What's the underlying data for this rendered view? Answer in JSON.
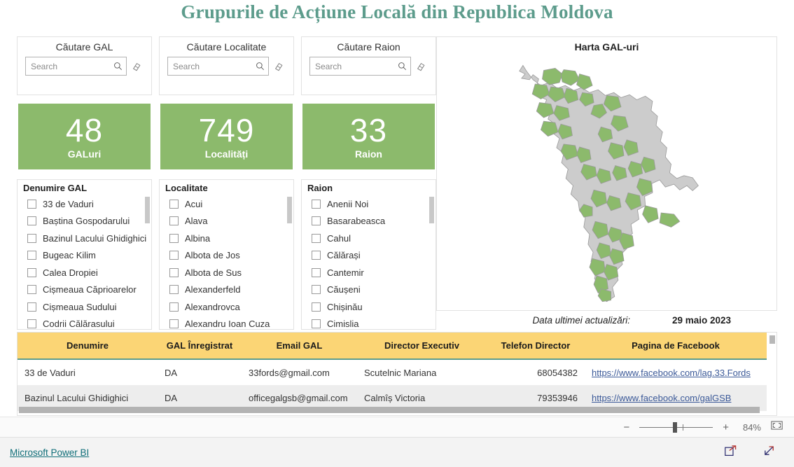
{
  "report": {
    "title": "Grupurile de Acțiune Locală din Republica Moldova",
    "accent_teal": "#5d9c8c",
    "kpi_green": "#8cba6c",
    "table_header_yellow": "#fbd575"
  },
  "slicers": [
    {
      "title": "Căutare GAL",
      "placeholder": "Search",
      "value": "",
      "search_icon": "search-icon",
      "clear_icon": "eraser-icon"
    },
    {
      "title": "Căutare Localitate",
      "placeholder": "Search",
      "value": "",
      "search_icon": "search-icon",
      "clear_icon": "eraser-icon"
    },
    {
      "title": "Căutare Raion",
      "placeholder": "Search",
      "value": "",
      "search_icon": "search-icon",
      "clear_icon": "eraser-icon"
    }
  ],
  "kpis": [
    {
      "value": "48",
      "label": "GALuri"
    },
    {
      "value": "749",
      "label": "Localități"
    },
    {
      "value": "33",
      "label": "Raion"
    }
  ],
  "lists": [
    {
      "header": "Denumire GAL",
      "items": [
        "33 de Vaduri",
        "Baștina Gospodarului",
        "Bazinul Lacului Ghidighici",
        "Bugeac Kilim",
        "Calea Dropiei",
        "Cișmeaua Căprioarelor",
        "Cișmeaua Sudului",
        "Codrii Călărasului"
      ]
    },
    {
      "header": "Localitate",
      "items": [
        "Acui",
        "Alava",
        "Albina",
        "Albota de Jos",
        "Albota de Sus",
        "Alexanderfeld",
        "Alexandrovca",
        "Alexandru Ioan Cuza"
      ]
    },
    {
      "header": "Raion",
      "items": [
        "Anenii Noi",
        "Basarabeasca",
        "Cahul",
        "Călărași",
        "Cantemir",
        "Căușeni",
        "Chișinău",
        "Cimislia"
      ]
    }
  ],
  "map": {
    "title": "Harta GAL-uri",
    "region_fill": "#8cba6c",
    "base_fill": "#cccccc"
  },
  "update": {
    "label": "Data ultimei actualizări:",
    "value": "29 maio 2023"
  },
  "table": {
    "columns": [
      "Denumire",
      "GAL Înregistrat",
      "Email GAL",
      "Director Executiv",
      "Telefon Director",
      "Pagina de Facebook"
    ],
    "rows": [
      {
        "denumire": "33 de Vaduri",
        "inregistrat": "DA",
        "email": "33fords@gmail.com",
        "director": "Scutelnic Mariana",
        "telefon": "68054382",
        "facebook": "https://www.facebook.com/lag.33.Fords"
      },
      {
        "denumire": "Bazinul Lacului Ghidighici",
        "inregistrat": "DA",
        "email": "officegalgsb@gmail.com",
        "director": "Calmîș Victoria",
        "telefon": "79353946",
        "facebook": "https://www.facebook.com/galGSB"
      }
    ]
  },
  "zoombar": {
    "minus": "−",
    "plus": "+",
    "percent": "84%",
    "fit_icon": "fit-to-page-icon"
  },
  "footer": {
    "brand": "Microsoft Power BI",
    "share_icon": "share-icon",
    "fullscreen_icon": "fullscreen-icon"
  }
}
